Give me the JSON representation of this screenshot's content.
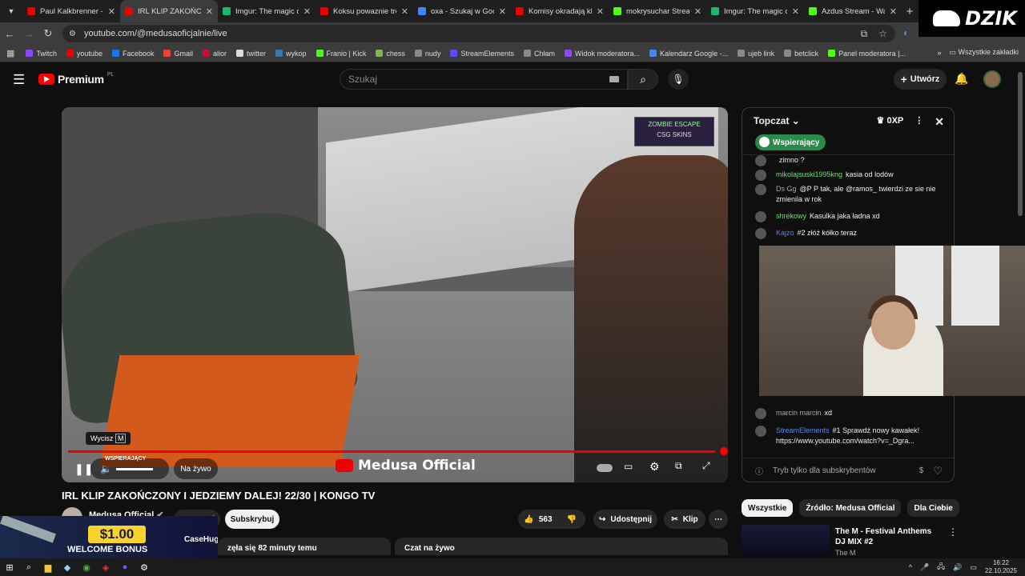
{
  "browser": {
    "tabs": [
      {
        "title": "Paul Kalkbrenner - Li",
        "color": "#e00"
      },
      {
        "title": "IRL KLIP ZAKOŃC",
        "color": "#e00",
        "active": true
      },
      {
        "title": "Imgur: The magic of t",
        "color": "#1bb76e"
      },
      {
        "title": "Koksu powaznie trem",
        "color": "#e00"
      },
      {
        "title": "oxa - Szukaj w Googl",
        "color": "#4285f4"
      },
      {
        "title": "Komisy okradają klien",
        "color": "#e00"
      },
      {
        "title": "mokrysuchar Stream",
        "color": "#53fc18"
      },
      {
        "title": "Imgur: The magic of t",
        "color": "#1bb76e"
      },
      {
        "title": "Azdus Stream - Watc",
        "color": "#53fc18"
      }
    ],
    "url": "youtube.com/@medusaoficjalnie/live",
    "bookmarks": [
      {
        "label": "Twitch",
        "color": "#9146ff"
      },
      {
        "label": "youtube",
        "color": "#e00"
      },
      {
        "label": "Facebook",
        "color": "#1877f2"
      },
      {
        "label": "Gmail",
        "color": "#ea4335"
      },
      {
        "label": "alior",
        "color": "#c8102e"
      },
      {
        "label": "twitter",
        "color": "#ddd"
      },
      {
        "label": "wykop",
        "color": "#367aa9"
      },
      {
        "label": "Franio | Kick",
        "color": "#53fc18"
      },
      {
        "label": "chess",
        "color": "#81b64c"
      },
      {
        "label": "nudy",
        "color": "#888"
      },
      {
        "label": "StreamElements",
        "color": "#5d4aff"
      },
      {
        "label": "Chłam",
        "color": "#888"
      },
      {
        "label": "Widok moderatora...",
        "color": "#9146ff"
      },
      {
        "label": "Kalendarz Google -...",
        "color": "#4285f4"
      },
      {
        "label": "ujeb link",
        "color": "#888"
      },
      {
        "label": "betclick",
        "color": "#888"
      },
      {
        "label": "Panel moderatora |...",
        "color": "#53fc18"
      }
    ],
    "all_bookmarks": "Wszystkie zakładki"
  },
  "overlay_brand": "DZIK",
  "youtube": {
    "logo": "Premium",
    "logo_region": "PL",
    "search_placeholder": "Szukaj",
    "create_label": "Utwórz"
  },
  "player": {
    "overlay_small": "ZOMBIE ESCAPE",
    "overlay_small2": "CSG SKINS",
    "mute_tooltip": "Wycisz",
    "mute_key": "M",
    "supporter_label": "WSPIERAJĄCY",
    "live_label": "Na żywo",
    "watermark": "Medusa Official",
    "progress": 0.99
  },
  "video": {
    "title": "IRL KLIP ZAKOŃCZONY I JEDZIEMY DALEJ! 22/30 | KONGO TV",
    "channel": "Medusa Official",
    "support_label": "Wesprzyj",
    "subscribe_label": "Subskrybuj",
    "likes": "563",
    "share_label": "Udostępnij",
    "clip_label": "Klip",
    "desc_left": "zęła się 82 minuty temu",
    "desc_right": "Czat na żywo"
  },
  "chat": {
    "header": "Topczat",
    "xp": "0XP",
    "badge": "Wspierający",
    "messages": [
      {
        "name": "",
        "text": "zimno ?",
        "color": "#aaa"
      },
      {
        "name": "mikolajsuski1995kng",
        "text": "kasia od lodów",
        "color": "#7dd87d"
      },
      {
        "name": "Ds Gg",
        "text": "@P P tak, ale @ramos_ twierdzi ze sie nie zmienila w rok",
        "color": "#aaa"
      },
      {
        "name": "shrekowy",
        "text": "Kasulka jaka ładna xd",
        "color": "#7dd87d"
      },
      {
        "name": "Kajzo",
        "text": "#2  złóż kółko teraz",
        "color": "#5e84f1"
      },
      {
        "name": "marcin marcin",
        "text": "xd",
        "color": "#aaa"
      },
      {
        "name": "StreamElements",
        "text": "#1  Sprawdź nowy kawałek! https://www.youtube.com/watch?v=_Dgra...",
        "color": "#5e84f1"
      }
    ],
    "input_placeholder": "Tryb tylko dla subskrybentów"
  },
  "related": {
    "chips": [
      "Wszystkie",
      "Źródło: Medusa Official",
      "Dla Ciebie"
    ],
    "title": "The M - Festival Anthems DJ MIX #2",
    "channel": "The M"
  },
  "ad": {
    "amount": "$1.00",
    "text": "WELCOME BONUS",
    "brand": "CaseHug"
  },
  "taskbar": {
    "time": "16:22",
    "date": "22.10.2025"
  }
}
